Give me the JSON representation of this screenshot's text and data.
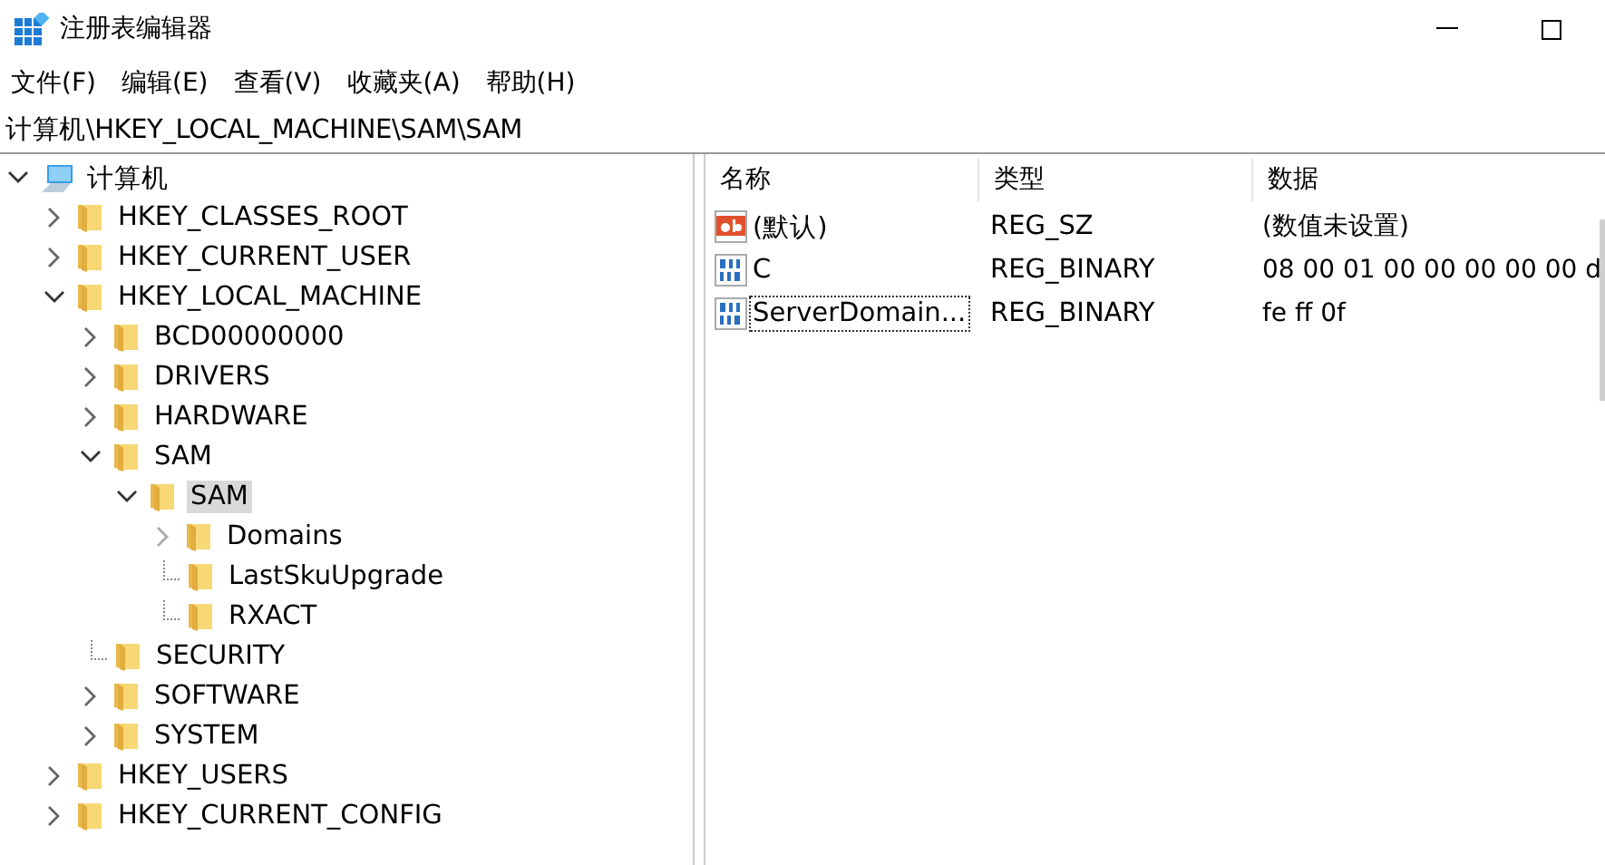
{
  "window": {
    "title": "注册表编辑器"
  },
  "menu": [
    "文件(F)",
    "编辑(E)",
    "查看(V)",
    "收藏夹(A)",
    "帮助(H)"
  ],
  "address": "计算机\\HKEY_LOCAL_MACHINE\\SAM\\SAM",
  "tree": [
    {
      "label": "计算机",
      "kind": "computer",
      "expanded": true,
      "selected": false,
      "children": [
        {
          "label": "HKEY_CLASSES_ROOT",
          "expanded": false,
          "selected": false
        },
        {
          "label": "HKEY_CURRENT_USER",
          "expanded": false,
          "selected": false
        },
        {
          "label": "HKEY_LOCAL_MACHINE",
          "expanded": true,
          "selected": false,
          "children": [
            {
              "label": "BCD00000000",
              "expanded": false,
              "selected": false
            },
            {
              "label": "DRIVERS",
              "expanded": false,
              "selected": false
            },
            {
              "label": "HARDWARE",
              "expanded": false,
              "selected": false
            },
            {
              "label": "SAM",
              "expanded": true,
              "selected": false,
              "children": [
                {
                  "label": "SAM",
                  "expanded": true,
                  "selected": true,
                  "children": [
                    {
                      "label": "Domains",
                      "expanded": false,
                      "selected": false
                    },
                    {
                      "label": "LastSkuUpgrade",
                      "selected": false
                    },
                    {
                      "label": "RXACT",
                      "selected": false
                    }
                  ]
                }
              ]
            },
            {
              "label": "SECURITY",
              "selected": false
            },
            {
              "label": "SOFTWARE",
              "expanded": false,
              "selected": false
            },
            {
              "label": "SYSTEM",
              "expanded": false,
              "selected": false
            }
          ]
        },
        {
          "label": "HKEY_USERS",
          "expanded": false,
          "selected": false
        },
        {
          "label": "HKEY_CURRENT_CONFIG",
          "expanded": false,
          "selected": false
        }
      ]
    }
  ],
  "table": {
    "columns": [
      "名称",
      "类型",
      "数据"
    ],
    "rows": [
      {
        "kind": "string",
        "name": "(默认)",
        "type": "REG_SZ",
        "data": "(数值未设置)",
        "focused": false
      },
      {
        "kind": "binary",
        "name": "C",
        "type": "REG_BINARY",
        "data": "08 00 01 00 00 00 00 00 d",
        "focused": false
      },
      {
        "kind": "binary",
        "name": "ServerDomain...",
        "type": "REG_BINARY",
        "data": "fe ff 0f",
        "focused": true
      }
    ]
  }
}
